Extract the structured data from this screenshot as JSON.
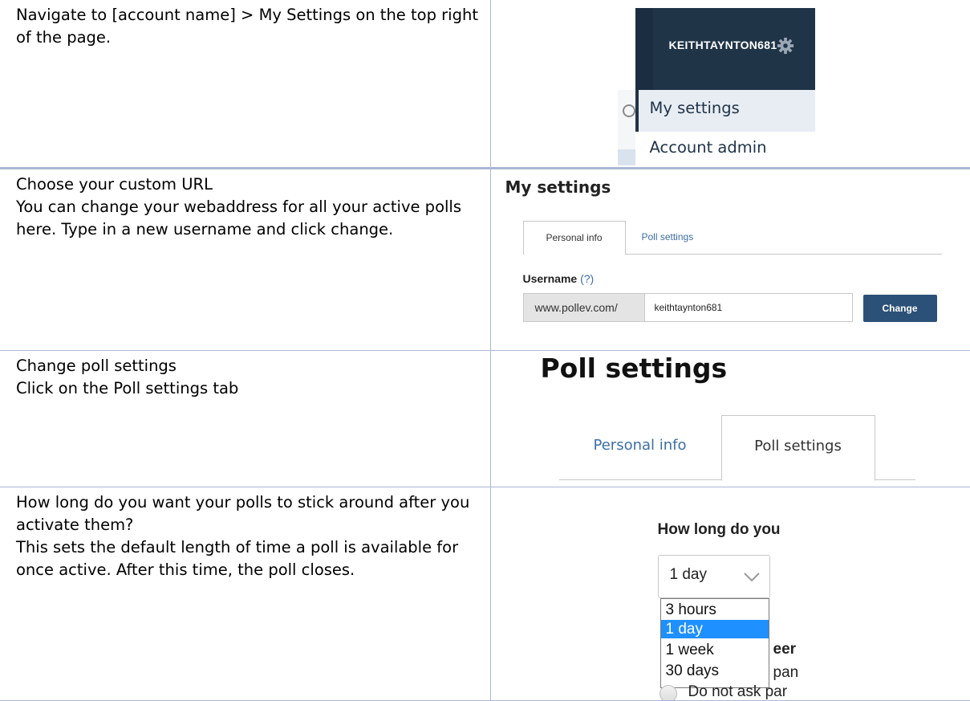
{
  "rows": [
    {
      "lines": [
        "Navigate to [account name] > My Settings on the top right of the page."
      ],
      "shot": {
        "account_name": "KEITHTAYNTON681",
        "menu_items": [
          "My settings",
          "Account admin"
        ]
      }
    },
    {
      "lines": [
        "Choose your custom URL",
        "You can change your webaddress for all your active polls here. Type in a new username and click change."
      ],
      "shot": {
        "title": "My settings",
        "tabs": [
          "Personal info",
          "Poll settings"
        ],
        "username_label": "Username",
        "help_link": "(?)",
        "url_prefix": "www.pollev.com/",
        "username_value": "keithtaynton681",
        "change_label": "Change"
      }
    },
    {
      "lines": [
        "Change poll settings",
        "Click on the Poll settings tab"
      ],
      "shot": {
        "title": "Poll settings",
        "tabs": [
          "Personal info",
          "Poll settings"
        ]
      }
    },
    {
      "lines": [
        "How long do you want your polls to stick around after you activate them?",
        "This sets the default length of time a poll is available for once active.  After this time, the poll closes."
      ],
      "shot": {
        "question_fragment": "How long do you",
        "selected_value": "1 day",
        "options": [
          "3 hours",
          "1 day",
          "1 week",
          "30 days"
        ],
        "fragment_1": "eer",
        "fragment_2": "pan",
        "fragment_3": "Do not ask par"
      }
    }
  ]
}
